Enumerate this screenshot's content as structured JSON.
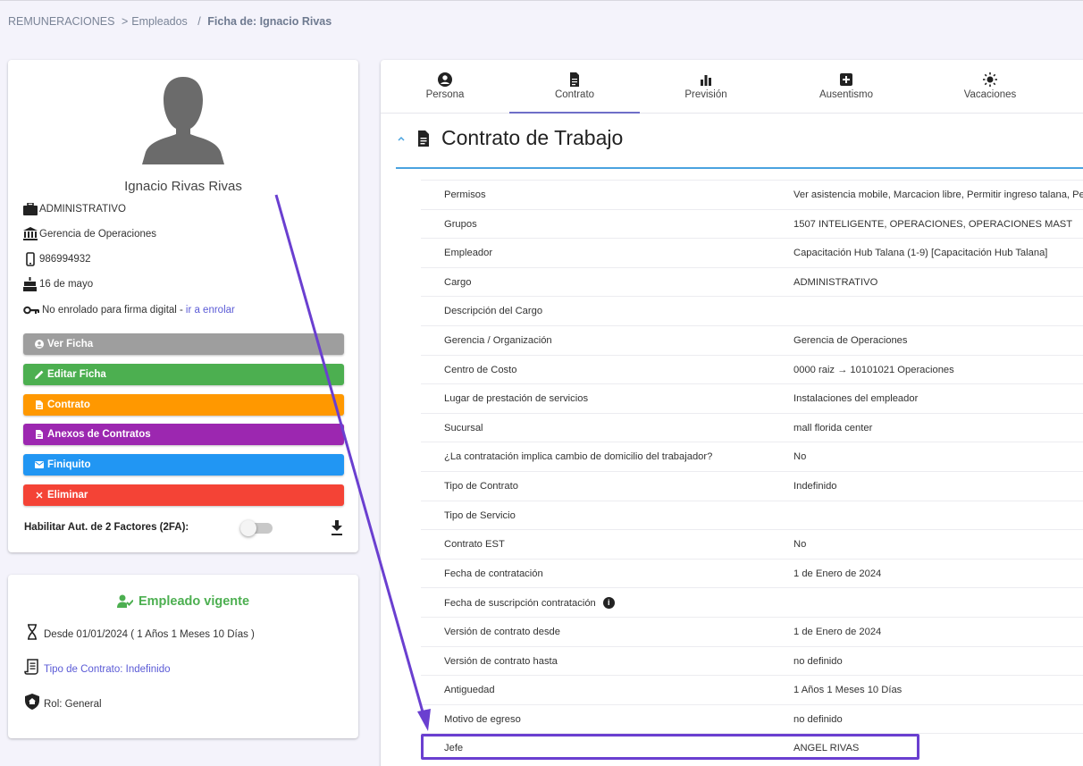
{
  "breadcrumb": {
    "root": "REMUNERACIONES",
    "sep": ">",
    "section": "Empleados",
    "sep2": "/",
    "current": "Ficha de: Ignacio Rivas"
  },
  "profile": {
    "avatar_icon": "user-silhouette-icon",
    "name": "Ignacio Rivas Rivas",
    "position": "ADMINISTRATIVO",
    "department": "Gerencia de Operaciones",
    "phone": "986994932",
    "birthday": "16 de mayo",
    "signature_status": "No enrolado para firma digital - ",
    "signature_link": "ir a enrolar",
    "buttons": [
      {
        "label": "Ver Ficha",
        "color": "#9e9e9e",
        "icon": "user-circle-icon"
      },
      {
        "label": "Editar Ficha",
        "color": "#4caf50",
        "icon": "pencil-icon"
      },
      {
        "label": "Contrato",
        "color": "#ff9800",
        "icon": "document-icon"
      },
      {
        "label": "Anexos de Contratos",
        "color": "#9c27b0",
        "icon": "document-icon"
      },
      {
        "label": "Finiquito",
        "color": "#2196f3",
        "icon": "mail-icon"
      },
      {
        "label": "Eliminar",
        "color": "#f44336",
        "icon": "close-icon"
      }
    ],
    "twofa_label": "Habilitar Aut. de 2 Factores (2FA):",
    "twofa_enabled": false
  },
  "status": {
    "title": "Empleado vigente",
    "since": "Desde 01/01/2024 ( 1 Años 1 Meses 10 Días )",
    "contract_type": "Tipo de Contrato: Indefinido",
    "role": "Rol: General"
  },
  "tabs": [
    {
      "label": "Persona",
      "icon": "user-circle-icon",
      "active": false
    },
    {
      "label": "Contrato",
      "icon": "document-icon",
      "active": true
    },
    {
      "label": "Previsión",
      "icon": "bar-chart-icon",
      "active": false
    },
    {
      "label": "Ausentismo",
      "icon": "medical-plus-icon",
      "active": false
    },
    {
      "label": "Vacaciones",
      "icon": "sun-icon",
      "active": false
    }
  ],
  "section": {
    "title": "Contrato de Trabajo"
  },
  "contract_rows": [
    {
      "key": "Permisos",
      "value": "Ver asistencia mobile, Marcacion libre, Permitir ingreso talana, Per"
    },
    {
      "key": "Grupos",
      "value": "1507 INTELIGENTE, OPERACIONES, OPERACIONES MAST"
    },
    {
      "key": "Empleador",
      "value": "Capacitación Hub Talana (1-9) [Capacitación Hub Talana]"
    },
    {
      "key": "Cargo",
      "value": "ADMINISTRATIVO"
    },
    {
      "key": "Descripción del Cargo",
      "value": ""
    },
    {
      "key": "Gerencia / Organización",
      "value": "Gerencia de Operaciones"
    },
    {
      "key": "Centro de Costo",
      "value": "0000 raiz → 10101021 Operaciones"
    },
    {
      "key": "Lugar de prestación de servicios",
      "value": "Instalaciones del empleador"
    },
    {
      "key": "Sucursal",
      "value": "mall florida center"
    },
    {
      "key": "¿La contratación implica cambio de domicilio del trabajador?",
      "value": "No"
    },
    {
      "key": "Tipo de Contrato",
      "value": "Indefinido"
    },
    {
      "key": "Tipo de Servicio",
      "value": ""
    },
    {
      "key": "Contrato EST",
      "value": "No"
    },
    {
      "key": "Fecha de contratación",
      "value": "1 de Enero de 2024"
    },
    {
      "key": "Fecha de suscripción contratación",
      "value": "",
      "info": "i"
    },
    {
      "key": "Versión de contrato desde",
      "value": "1 de Enero de 2024"
    },
    {
      "key": "Versión de contrato hasta",
      "value": "no definido"
    },
    {
      "key": "Antiguedad",
      "value": "1 Años 1 Meses 10 Días"
    },
    {
      "key": "Motivo de egreso",
      "value": "no definido"
    },
    {
      "key": "Jefe",
      "value": "ANGEL RIVAS"
    }
  ],
  "annotation_color": "#6a3fd0"
}
